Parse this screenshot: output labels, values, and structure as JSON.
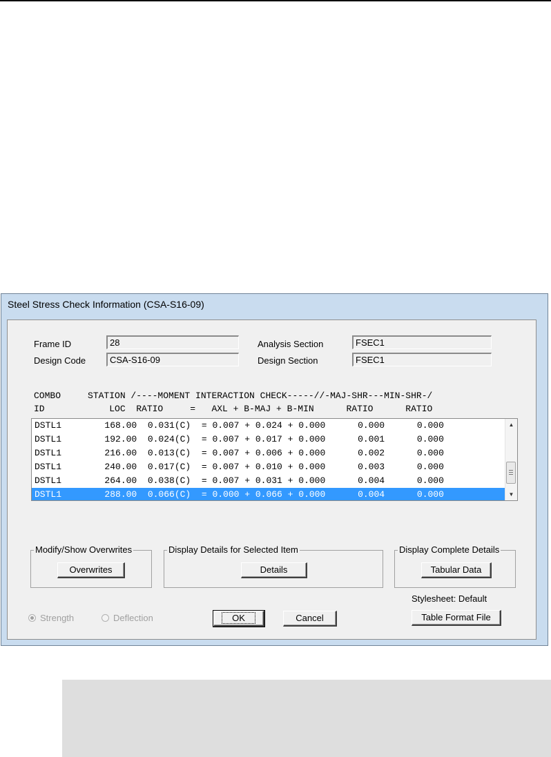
{
  "window": {
    "title": "Steel Stress Check Information (CSA-S16-09)"
  },
  "fields": {
    "frame_id_label": "Frame ID",
    "frame_id_value": "28",
    "design_code_label": "Design Code",
    "design_code_value": "CSA-S16-09",
    "analysis_section_label": "Analysis Section",
    "analysis_section_value": "FSEC1",
    "design_section_label": "Design Section",
    "design_section_value": "FSEC1"
  },
  "table": {
    "header1": "COMBO     STATION /----MOMENT INTERACTION CHECK-----//-MAJ-SHR---MIN-SHR-/",
    "header2": "ID            LOC  RATIO     =   AXL + B-MAJ + B-MIN      RATIO      RATIO",
    "rows": [
      {
        "combo": "DSTL1",
        "loc": "168.00",
        "ratio": "0.031(C)",
        "axl": "0.007",
        "bmaj": "0.024",
        "bmin": "0.000",
        "maj_shr": "0.000",
        "min_shr": "0.000"
      },
      {
        "combo": "DSTL1",
        "loc": "192.00",
        "ratio": "0.024(C)",
        "axl": "0.007",
        "bmaj": "0.017",
        "bmin": "0.000",
        "maj_shr": "0.001",
        "min_shr": "0.000"
      },
      {
        "combo": "DSTL1",
        "loc": "216.00",
        "ratio": "0.013(C)",
        "axl": "0.007",
        "bmaj": "0.006",
        "bmin": "0.000",
        "maj_shr": "0.002",
        "min_shr": "0.000"
      },
      {
        "combo": "DSTL1",
        "loc": "240.00",
        "ratio": "0.017(C)",
        "axl": "0.007",
        "bmaj": "0.010",
        "bmin": "0.000",
        "maj_shr": "0.003",
        "min_shr": "0.000"
      },
      {
        "combo": "DSTL1",
        "loc": "264.00",
        "ratio": "0.038(C)",
        "axl": "0.007",
        "bmaj": "0.031",
        "bmin": "0.000",
        "maj_shr": "0.004",
        "min_shr": "0.000"
      },
      {
        "combo": "DSTL1",
        "loc": "288.00",
        "ratio": "0.066(C)",
        "axl": "0.000",
        "bmaj": "0.066",
        "bmin": "0.000",
        "maj_shr": "0.004",
        "min_shr": "0.000"
      }
    ],
    "selected_index": 5
  },
  "groups": {
    "overwrites_caption": "Modify/Show Overwrites",
    "overwrites_button": "Overwrites",
    "details_caption": "Display Details for Selected Item",
    "details_button": "Details",
    "complete_caption": "Display Complete Details",
    "tabular_button": "Tabular Data"
  },
  "stylesheet_label": "Stylesheet: Default",
  "table_format_button": "Table Format File",
  "radio": {
    "strength": "Strength",
    "deflection": "Deflection",
    "selected": "strength"
  },
  "buttons": {
    "ok": "OK",
    "cancel": "Cancel"
  },
  "colors": {
    "selection": "#3399ff",
    "title_bar": "#c9dcef"
  }
}
